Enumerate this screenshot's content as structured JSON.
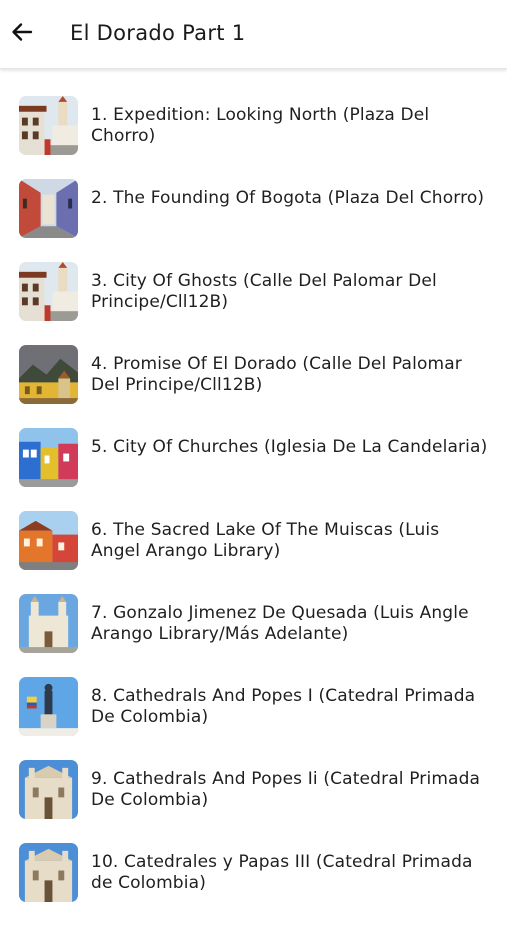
{
  "header": {
    "title": "El Dorado Part 1",
    "back_icon": "arrow-left-icon"
  },
  "items": [
    {
      "label": "1. Expedition: Looking North (Plaza Del Chorro)",
      "thumb": "street-tower"
    },
    {
      "label": "2. The Founding Of Bogota (Plaza Del Chorro)",
      "thumb": "alley"
    },
    {
      "label": "3. City Of Ghosts (Calle Del Palomar Del Principe/Cll12B)",
      "thumb": "street-tower"
    },
    {
      "label": "4. Promise Of El Dorado (Calle Del Palomar Del Principe/Cll12B)",
      "thumb": "mountain-town"
    },
    {
      "label": "5. City Of Churches (Iglesia De La Candelaria)",
      "thumb": "colorful-houses"
    },
    {
      "label": "6. The Sacred Lake Of The Muiscas (Luis Angel Arango Library)",
      "thumb": "orange-houses"
    },
    {
      "label": "7. Gonzalo Jimenez De Quesada (Luis Angle Arango Library/Más Adelante)",
      "thumb": "cathedral-front"
    },
    {
      "label": "8. Cathedrals And Popes I (Catedral Primada De Colombia)",
      "thumb": "statue"
    },
    {
      "label": "9. Cathedrals And Popes Ii (Catedral Primada De Colombia)",
      "thumb": "cathedral-facade"
    },
    {
      "label": "10. Catedrales y Papas III (Catedral Primada de Colombia)",
      "thumb": "cathedral-facade"
    }
  ]
}
